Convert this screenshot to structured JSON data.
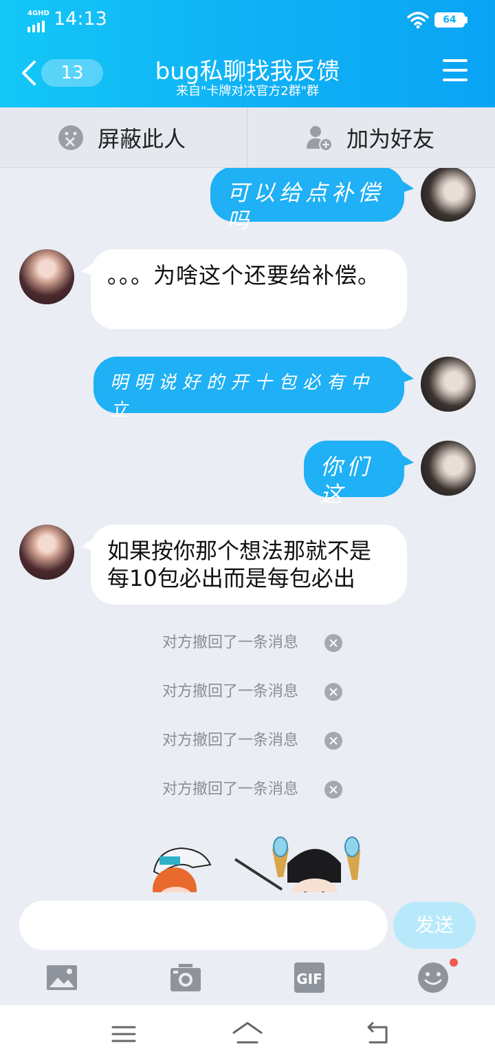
{
  "status_bar": {
    "network": "4GHD",
    "time": "14:13",
    "battery": "64"
  },
  "header": {
    "back_count": "13",
    "title": "bug私聊找我反馈",
    "subtitle": "来自\"卡牌对决官方2群\"群"
  },
  "actions": {
    "block_label": "屏蔽此人",
    "add_friend_label": "加为好友"
  },
  "messages": [
    {
      "from": "me",
      "text": "可以给点补偿吗"
    },
    {
      "from": "other",
      "text": "。。。为啥这个还要给补偿。"
    },
    {
      "from": "me",
      "text": "明明说好的开十包必有中立"
    },
    {
      "from": "me",
      "text": "你们这"
    },
    {
      "from": "other",
      "text": "如果按你那个想法那就不是每10包必出而是每包必出"
    }
  ],
  "recalls": [
    "对方撤回了一条消息",
    "对方撤回了一条消息",
    "对方撤回了一条消息",
    "对方撤回了一条消息"
  ],
  "input": {
    "value": "",
    "send_label": "发送"
  },
  "toolbar": {
    "gif_label": "GIF"
  },
  "colors": {
    "header": "#0fb0f5",
    "outgoing_bubble": "#1fb0f5",
    "send_button": "#b7e9fb"
  }
}
